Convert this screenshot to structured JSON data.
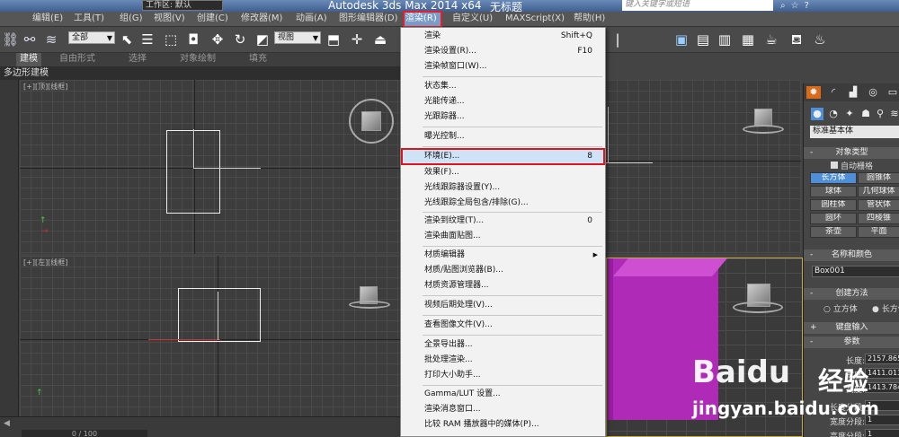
{
  "titlebar": {
    "workspace": "工作区: 默认",
    "app_name": "Autodesk 3ds Max  2014 x64",
    "document": "无标题",
    "search_placeholder": "键入关键字或短语"
  },
  "menubar": {
    "items": [
      "编辑(E)",
      "工具(T)",
      "组(G)",
      "视图(V)",
      "创建(C)",
      "修改器(M)",
      "动画(A)",
      "图形编辑器(D)",
      "渲染(R)",
      "自定义(U)",
      "MAXScript(X)",
      "帮助(H)"
    ],
    "active": "渲染(R)"
  },
  "toolbar": {
    "selection_filter": "全部",
    "reference_coord": "视图"
  },
  "ribbon_tabs": [
    "建模",
    "自由形式",
    "选择",
    "对象绘制",
    "填充"
  ],
  "ribbon_subtitle": "多边形建模",
  "viewports": {
    "top_label": "[+][顶][线框]",
    "left_label": "[+][左][线框]"
  },
  "render_menu": {
    "items": [
      {
        "label": "渲染",
        "shortcut": "Shift+Q"
      },
      {
        "label": "渲染设置(R)...",
        "shortcut": "F10"
      },
      {
        "label": "渲染帧窗口(W)...",
        "shortcut": ""
      },
      {
        "label": "状态集...",
        "shortcut": ""
      },
      {
        "label": "光能传递...",
        "shortcut": ""
      },
      {
        "label": "光跟踪器...",
        "shortcut": ""
      },
      {
        "label": "曝光控制...",
        "shortcut": ""
      },
      {
        "label": "环境(E)...",
        "shortcut": "8",
        "highlighted": true
      },
      {
        "label": "效果(F)...",
        "shortcut": ""
      },
      {
        "label": "光线跟踪器设置(Y)...",
        "shortcut": ""
      },
      {
        "label": "光线跟踪全局包含/排除(G)...",
        "shortcut": ""
      },
      {
        "label": "渲染到纹理(T)...",
        "shortcut": "0"
      },
      {
        "label": "渲染曲面贴图...",
        "shortcut": ""
      },
      {
        "label": "材质编辑器",
        "shortcut": "",
        "submenu": true
      },
      {
        "label": "材质/贴图浏览器(B)...",
        "shortcut": ""
      },
      {
        "label": "材质资源管理器...",
        "shortcut": ""
      },
      {
        "label": "视频后期处理(V)...",
        "shortcut": ""
      },
      {
        "label": "查看图像文件(V)...",
        "shortcut": ""
      },
      {
        "label": "全景导出器...",
        "shortcut": ""
      },
      {
        "label": "批处理渲染...",
        "shortcut": ""
      },
      {
        "label": "打印大小助手...",
        "shortcut": ""
      },
      {
        "label": "Gamma/LUT 设置...",
        "shortcut": ""
      },
      {
        "label": "渲染消息窗口...",
        "shortcut": ""
      },
      {
        "label": "比较 RAM 播放器中的媒体(P)...",
        "shortcut": ""
      }
    ]
  },
  "command_panel": {
    "category_select": "标准基本体",
    "object_type_header": "对象类型",
    "autogrid_label": "自动栅格",
    "object_buttons": [
      "长方体",
      "圆锥体",
      "球体",
      "几何球体",
      "圆柱体",
      "管状体",
      "圆环",
      "四棱锥",
      "茶壶",
      "平面"
    ],
    "active_object": "长方体",
    "name_color_header": "名称和颜色",
    "object_name": "Box001",
    "creation_method_header": "创建方法",
    "creation_options": [
      "立方体",
      "长方体"
    ],
    "creation_selected": "长方体",
    "keyboard_entry_header": "键盘输入",
    "params_header": "参数",
    "params": [
      {
        "label": "长度:",
        "value": "2157.865"
      },
      {
        "label": "宽度:",
        "value": "1411.013"
      },
      {
        "label": "高度:",
        "value": "1413.784"
      },
      {
        "label": "长度分段:",
        "value": "1"
      },
      {
        "label": "宽度分段:",
        "value": "1"
      },
      {
        "label": "高度分段:",
        "value": "1"
      }
    ]
  },
  "statusbar": {
    "timeline": "0 / 100"
  },
  "watermark": {
    "brand": "Baidu",
    "product": "经验",
    "url": "jingyan.baidu.com"
  }
}
